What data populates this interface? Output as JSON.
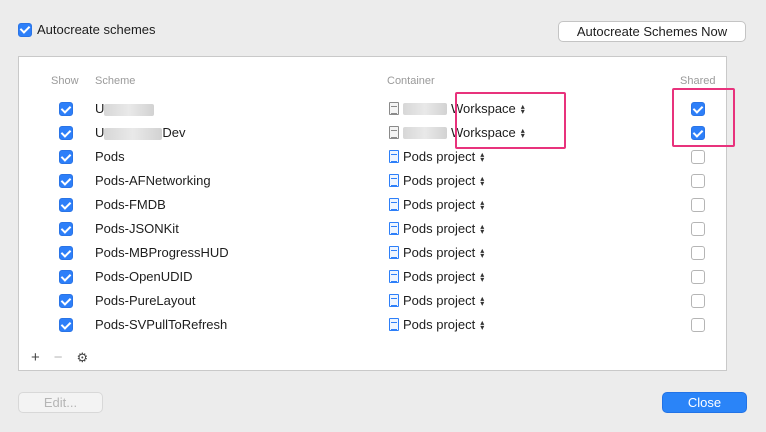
{
  "autocreate": {
    "label": "Autocreate schemes",
    "checked": true
  },
  "buttons": {
    "autocreate_now": "Autocreate Schemes Now",
    "edit": "Edit...",
    "close": "Close"
  },
  "columns": {
    "show": "Show",
    "scheme": "Scheme",
    "container": "Container",
    "shared": "Shared"
  },
  "rows": [
    {
      "show": true,
      "scheme_prefix": "U",
      "scheme_suffix": "",
      "container": "Workspace",
      "container_kind": "workspace",
      "shared": true
    },
    {
      "show": true,
      "scheme_prefix": "U",
      "scheme_suffix": "Dev",
      "container": "Workspace",
      "container_kind": "workspace",
      "shared": true
    },
    {
      "show": true,
      "scheme": "Pods",
      "container": "Pods project",
      "container_kind": "project",
      "shared": false
    },
    {
      "show": true,
      "scheme": "Pods-AFNetworking",
      "container": "Pods project",
      "container_kind": "project",
      "shared": false
    },
    {
      "show": true,
      "scheme": "Pods-FMDB",
      "container": "Pods project",
      "container_kind": "project",
      "shared": false
    },
    {
      "show": true,
      "scheme": "Pods-JSONKit",
      "container": "Pods project",
      "container_kind": "project",
      "shared": false
    },
    {
      "show": true,
      "scheme": "Pods-MBProgressHUD",
      "container": "Pods project",
      "container_kind": "project",
      "shared": false
    },
    {
      "show": true,
      "scheme": "Pods-OpenUDID",
      "container": "Pods project",
      "container_kind": "project",
      "shared": false
    },
    {
      "show": true,
      "scheme": "Pods-PureLayout",
      "container": "Pods project",
      "container_kind": "project",
      "shared": false
    },
    {
      "show": true,
      "scheme": "Pods-SVPullToRefresh",
      "container": "Pods project",
      "container_kind": "project",
      "shared": false
    }
  ],
  "footer": {
    "add": "+",
    "remove": "−",
    "settings": "⚙"
  },
  "icons": {
    "chevron": "⌃⌄",
    "file": "file-icon",
    "gear": "gear-icon"
  },
  "colors": {
    "accent": "#2d7ff9",
    "highlight": "#e8327c",
    "primary_button": "#2a84f8"
  }
}
